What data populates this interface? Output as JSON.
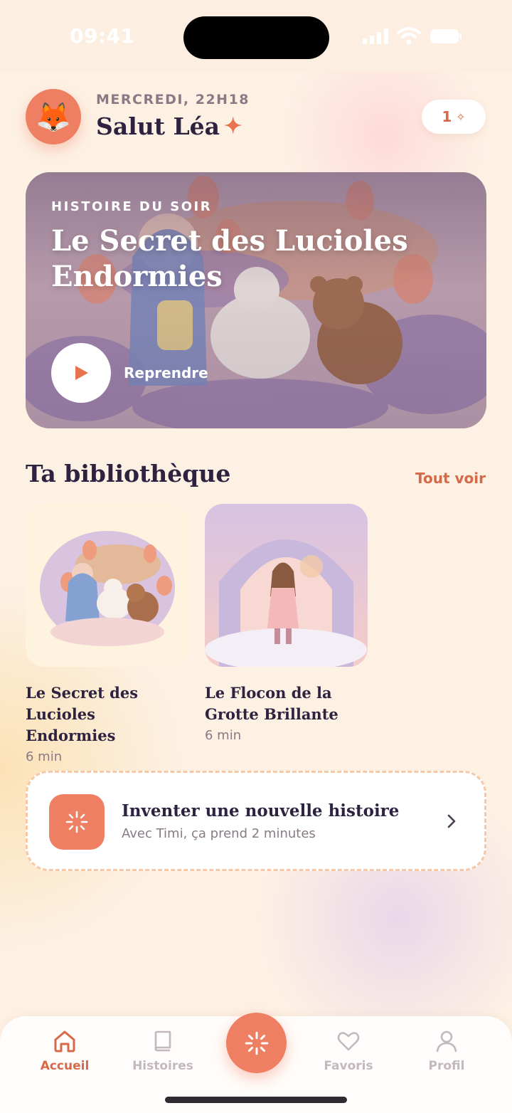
{
  "status_bar": {
    "time": "09:41"
  },
  "header": {
    "avatar_icon": "fox-face-icon",
    "avatar_emoji": "🦊",
    "date": "MERCREDI, 22H18",
    "greeting": "Salut Léa",
    "sparkle": "✦",
    "credits": "1",
    "credits_icon": "✧"
  },
  "hero": {
    "kicker": "HISTOIRE DU SOIR",
    "title": "Le Secret des Lucioles Endormies",
    "play_label": "Reprendre"
  },
  "library": {
    "title": "Ta bibliothèque",
    "see_all": "Tout voir",
    "books": [
      {
        "title": "Le Secret des Lucioles Endormies",
        "duration": "6 min"
      },
      {
        "title": "Le Flocon de la Grotte Brillante",
        "duration": "6 min"
      }
    ]
  },
  "create": {
    "title": "Inventer une nouvelle histoire",
    "subtitle": "Avec Timi, ça prend 2 minutes"
  },
  "tabs": [
    {
      "label": "Accueil",
      "icon": "home-icon",
      "active": true
    },
    {
      "label": "Histoires",
      "icon": "book-icon",
      "active": false
    },
    {
      "label": "Favoris",
      "icon": "heart-icon",
      "active": false
    },
    {
      "label": "Profil",
      "icon": "user-icon",
      "active": false
    }
  ],
  "colors": {
    "accent": "#ef7f62",
    "accent_text": "#d6694a",
    "background": "#fdf1e4",
    "title_text": "#2d2340",
    "muted_text": "#8a7a85"
  }
}
